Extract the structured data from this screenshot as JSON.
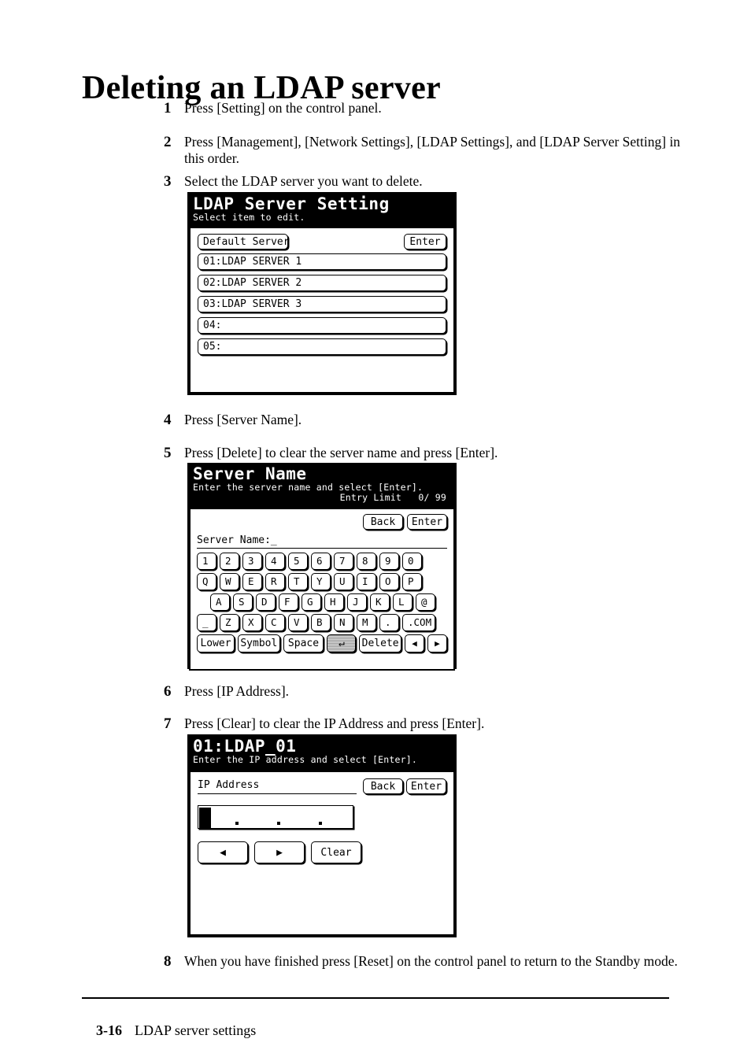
{
  "document": {
    "title": "Deleting an LDAP server",
    "footer": {
      "page_number": "3-16",
      "section": "LDAP server settings"
    }
  },
  "steps": [
    {
      "number": "1",
      "text": "Press [Setting] on the control panel."
    },
    {
      "number": "2",
      "text": "Press [Management], [Network Settings], [LDAP Settings], and [LDAP Server Setting] in this order."
    },
    {
      "number": "3",
      "text": "Select the LDAP server you want to delete."
    },
    {
      "number": "4",
      "text": "Press [Server Name]."
    },
    {
      "number": "5",
      "text": "Press [Delete] to clear the server name and press [Enter]."
    },
    {
      "number": "6",
      "text": "Press [IP Address]."
    },
    {
      "number": "7",
      "text": "Press [Clear] to clear the IP Address and press [Enter]."
    },
    {
      "number": "8",
      "text": "When you have finished press [Reset] on the control panel to return to the Standby mode."
    }
  ],
  "panel_ldap_setting": {
    "title": "LDAP Server Setting",
    "subtitle": "Select item to edit.",
    "default_server_button": "Default Server",
    "enter_button": "Enter",
    "server_list": [
      "01:LDAP SERVER 1",
      "02:LDAP SERVER 2",
      "03:LDAP SERVER 3",
      "04:",
      "05:"
    ]
  },
  "panel_server_name": {
    "title": "Server Name",
    "subtitle": "Enter the server name and select [Enter].",
    "entry_limit": "Entry Limit   0/ 99",
    "back_button": "Back",
    "enter_button": "Enter",
    "field_label": "Server Name:_",
    "keyboard": {
      "row1": [
        "1",
        "2",
        "3",
        "4",
        "5",
        "6",
        "7",
        "8",
        "9",
        "0"
      ],
      "row2": [
        "Q",
        "W",
        "E",
        "R",
        "T",
        "Y",
        "U",
        "I",
        "O",
        "P"
      ],
      "row3": [
        "A",
        "S",
        "D",
        "F",
        "G",
        "H",
        "J",
        "K",
        "L",
        "@"
      ],
      "row4": [
        "_",
        "Z",
        "X",
        "C",
        "V",
        "B",
        "N",
        "M",
        ".",
        ".COM"
      ],
      "functions": {
        "lower": "Lower",
        "symbol": "Symbol",
        "space": "Space",
        "return": "↵",
        "delete": "Delete",
        "left": "◀",
        "right": "▶"
      }
    }
  },
  "panel_ldap_01": {
    "title": "01:LDAP_01",
    "subtitle": "Enter the IP address and select [Enter].",
    "field_label": "IP Address",
    "back_button": "Back",
    "enter_button": "Enter",
    "ip_value": "",
    "left_button": "◀",
    "right_button": "▶",
    "clear_button": "Clear"
  }
}
